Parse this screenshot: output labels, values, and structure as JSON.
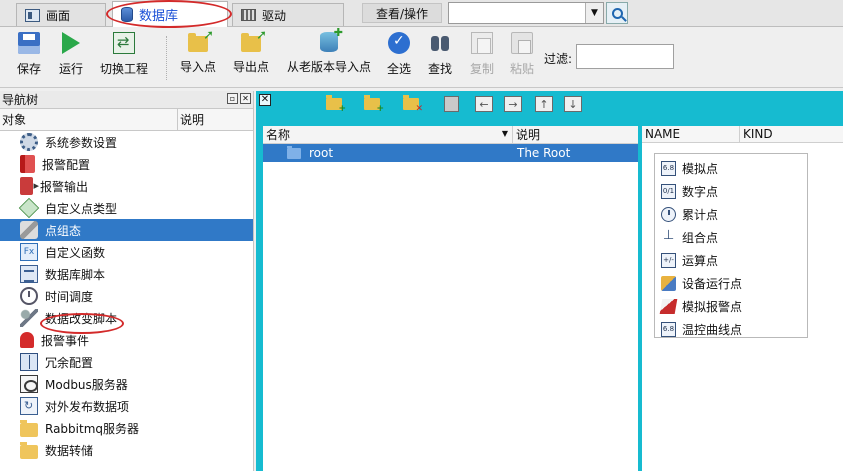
{
  "tabs": [
    {
      "label": "画面",
      "icon": "screen-icon"
    },
    {
      "label": "数据库",
      "icon": "database-icon"
    },
    {
      "label": "驱动",
      "icon": "driver-icon"
    }
  ],
  "view_ops_label": "查看/操作",
  "search": {
    "value": ""
  },
  "toolbar": {
    "buttons": [
      {
        "label": "保存",
        "icon": "save-icon",
        "enabled": true
      },
      {
        "label": "运行",
        "icon": "run-icon",
        "enabled": true
      },
      {
        "label": "切换工程",
        "icon": "switch-project-icon",
        "enabled": true
      },
      {
        "label": "导入点",
        "icon": "import-folder-icon",
        "enabled": true
      },
      {
        "label": "导出点",
        "icon": "export-folder-icon",
        "enabled": true
      },
      {
        "label": "从老版本导入点",
        "icon": "db-import-icon",
        "enabled": true
      },
      {
        "label": "全选",
        "icon": "check-icon",
        "enabled": true
      },
      {
        "label": "查找",
        "icon": "binoculars-icon",
        "enabled": true
      },
      {
        "label": "复制",
        "icon": "copy-icon",
        "enabled": false
      },
      {
        "label": "粘贴",
        "icon": "paste-icon",
        "enabled": false
      }
    ],
    "filter_label": "过滤:",
    "filter_value": ""
  },
  "nav": {
    "title": "导航树",
    "col_object": "对象",
    "col_desc": "说明",
    "items": [
      {
        "label": "系统参数设置",
        "icon": "gear-icon"
      },
      {
        "label": "报警配置",
        "icon": "alarm-config-icon"
      },
      {
        "label": "报警输出",
        "icon": "alarm-output-icon"
      },
      {
        "label": "自定义点类型",
        "icon": "point-type-icon"
      },
      {
        "label": "点组态",
        "icon": "point-config-icon",
        "selected": true
      },
      {
        "label": "自定义函数",
        "icon": "function-icon"
      },
      {
        "label": "数据库脚本",
        "icon": "script-icon"
      },
      {
        "label": "时间调度",
        "icon": "clock-icon"
      },
      {
        "label": "数据改变脚本",
        "icon": "wrench-icon"
      },
      {
        "label": "报警事件",
        "icon": "bell-icon"
      },
      {
        "label": "冗余配置",
        "icon": "redundancy-icon"
      },
      {
        "label": "Modbus服务器",
        "icon": "modbus-icon"
      },
      {
        "label": "对外发布数据项",
        "icon": "publish-icon"
      },
      {
        "label": "Rabbitmq服务器",
        "icon": "folder-icon"
      },
      {
        "label": "数据转储",
        "icon": "folder-icon"
      }
    ]
  },
  "points": {
    "col_name": "名称",
    "col_desc": "说明",
    "rows": [
      {
        "name": "root",
        "desc": "The Root"
      }
    ]
  },
  "kinds": {
    "col_name": "NAME",
    "col_kind": "KIND",
    "items": [
      {
        "label": "模拟点",
        "badge": "6.8"
      },
      {
        "label": "数字点",
        "badge": "0/1"
      },
      {
        "label": "累计点",
        "badge": ""
      },
      {
        "label": "组合点",
        "badge": ""
      },
      {
        "label": "运算点",
        "badge": "+/-"
      },
      {
        "label": "设备运行点",
        "badge": ""
      },
      {
        "label": "模拟报警点",
        "badge": ""
      },
      {
        "label": "温控曲线点",
        "badge": "6.8"
      }
    ]
  },
  "colors": {
    "accent": "#3079c7",
    "teal": "#16bbd0",
    "highlight": "#d32a2a"
  }
}
